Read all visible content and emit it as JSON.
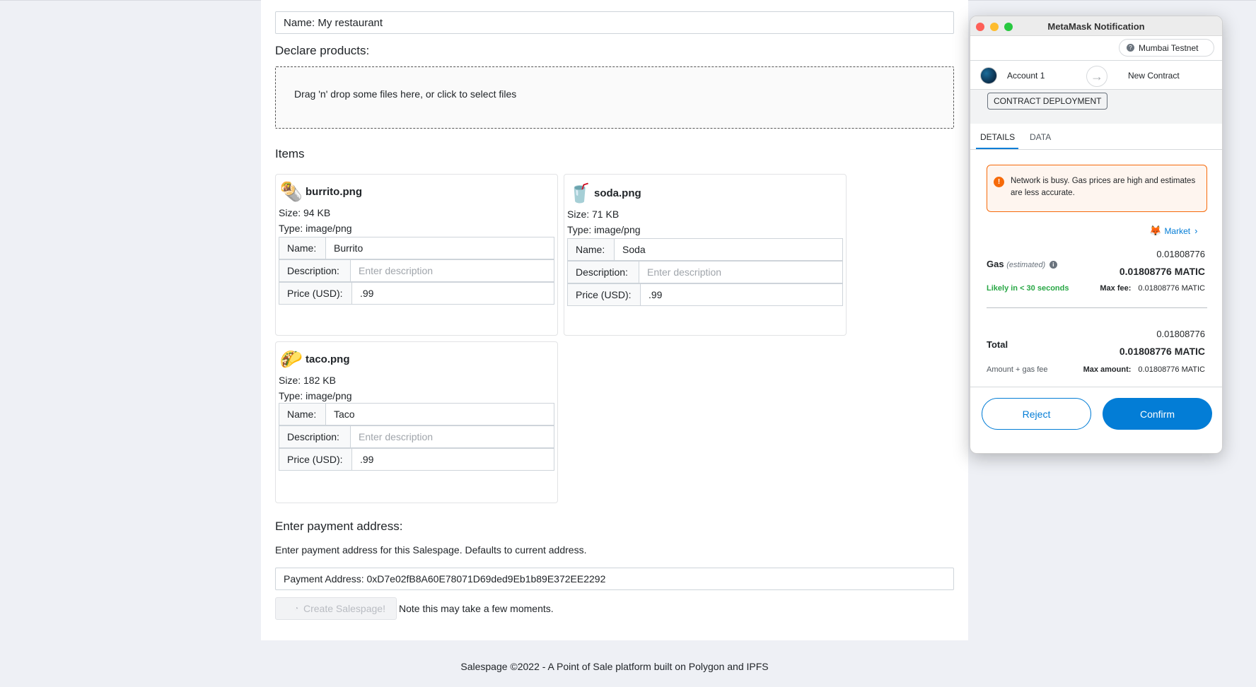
{
  "form": {
    "name_field": "Name: My restaurant",
    "declare_heading": "Declare products:",
    "dropzone_text": "Drag 'n' drop some files here, or click to select files",
    "items_heading": "Items"
  },
  "items": [
    {
      "icon": "🌯",
      "filename": "burrito.png",
      "size": "Size: 94 KB",
      "type": "Type: image/png",
      "name_label": "Name:",
      "name_value": "Burrito",
      "desc_label": "Description:",
      "desc_placeholder": "Enter description",
      "price_label": "Price (USD):",
      "price_value": ".99"
    },
    {
      "icon": "🥤",
      "filename": "soda.png",
      "size": "Size: 71 KB",
      "type": "Type: image/png",
      "name_label": "Name:",
      "name_value": "Soda",
      "desc_label": "Description:",
      "desc_placeholder": "Enter description",
      "price_label": "Price (USD):",
      "price_value": ".99"
    },
    {
      "icon": "🌮",
      "filename": "taco.png",
      "size": "Size: 182 KB",
      "type": "Type: image/png",
      "name_label": "Name:",
      "name_value": "Taco",
      "desc_label": "Description:",
      "desc_placeholder": "Enter description",
      "price_label": "Price (USD):",
      "price_value": ".99"
    }
  ],
  "payment": {
    "heading": "Enter payment address:",
    "description": "Enter payment address for this Salespage. Defaults to current address.",
    "address_field": "Payment Address: 0xD7e02fB8A60E78071D69ded9Eb1b89E372EE2292",
    "create_button": "Create Salespage!",
    "note": "Note this may take a few moments."
  },
  "footer": "Salespage ©2022 - A Point of Sale platform built on Polygon and IPFS",
  "metamask": {
    "window_title": "MetaMask Notification",
    "network": "Mumbai Testnet",
    "from_account": "Account 1",
    "to_account": "New Contract",
    "action_pill": "CONTRACT DEPLOYMENT",
    "tabs": [
      "DETAILS",
      "DATA"
    ],
    "warning": "Network is busy. Gas prices are high and estimates are less accurate.",
    "market_link": "Market",
    "gas_label": "Gas",
    "gas_estimated": "(estimated)",
    "gas_amount": "0.01808776",
    "gas_amount_matic": "0.01808776 MATIC",
    "likely": "Likely in < 30 seconds",
    "max_fee_label": "Max fee:",
    "max_fee_value": "0.01808776 MATIC",
    "total_label": "Total",
    "total_amount": "0.01808776",
    "total_amount_matic": "0.01808776 MATIC",
    "amount_gas_fee": "Amount + gas fee",
    "max_amount_label": "Max amount:",
    "max_amount_value": "0.01808776 MATIC",
    "reject_button": "Reject",
    "confirm_button": "Confirm"
  },
  "colors": {
    "accent": "#037dd6",
    "warning": "#f66a0a",
    "success": "#28a745"
  }
}
